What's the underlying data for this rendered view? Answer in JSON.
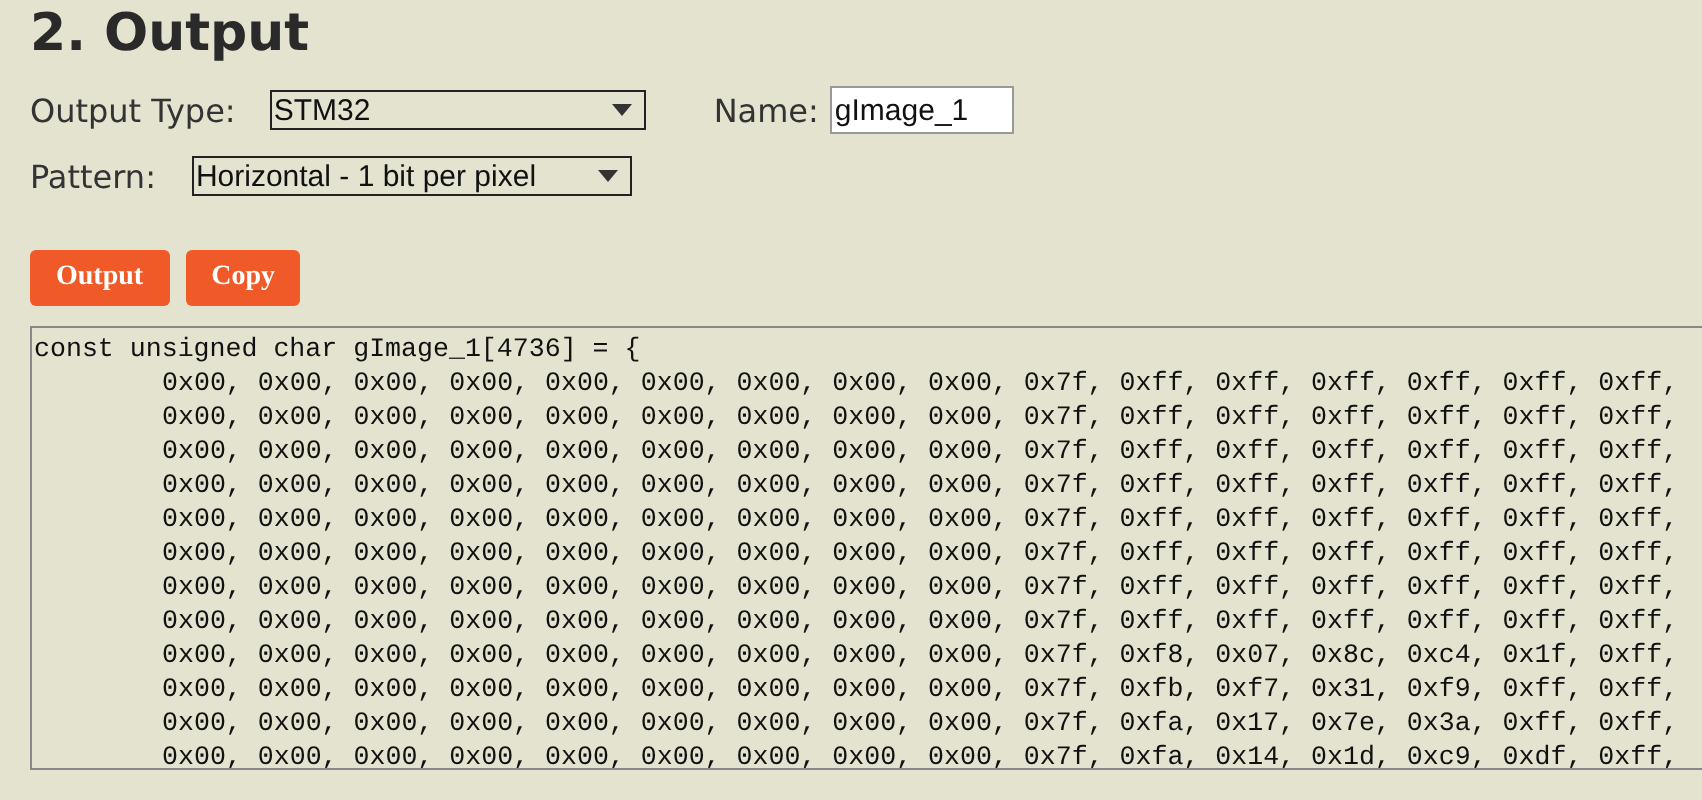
{
  "heading": "2. Output",
  "output_type": {
    "label": "Output Type:",
    "value": "STM32"
  },
  "name": {
    "label": "Name:",
    "value": "gImage_1"
  },
  "pattern": {
    "label": "Pattern:",
    "value": "Horizontal - 1 bit per pixel"
  },
  "buttons": [
    "Output",
    "Copy"
  ],
  "output": {
    "header": "const unsigned char gImage_1[4736] = {",
    "lines": [
      "0x00, 0x00, 0x00, 0x00, 0x00, 0x00, 0x00, 0x00, 0x00, 0x7f, 0xff, 0xff, 0xff, 0xff, 0xff, 0xff,",
      "0x00, 0x00, 0x00, 0x00, 0x00, 0x00, 0x00, 0x00, 0x00, 0x7f, 0xff, 0xff, 0xff, 0xff, 0xff, 0xff,",
      "0x00, 0x00, 0x00, 0x00, 0x00, 0x00, 0x00, 0x00, 0x00, 0x7f, 0xff, 0xff, 0xff, 0xff, 0xff, 0xff,",
      "0x00, 0x00, 0x00, 0x00, 0x00, 0x00, 0x00, 0x00, 0x00, 0x7f, 0xff, 0xff, 0xff, 0xff, 0xff, 0xff,",
      "0x00, 0x00, 0x00, 0x00, 0x00, 0x00, 0x00, 0x00, 0x00, 0x7f, 0xff, 0xff, 0xff, 0xff, 0xff, 0xff,",
      "0x00, 0x00, 0x00, 0x00, 0x00, 0x00, 0x00, 0x00, 0x00, 0x7f, 0xff, 0xff, 0xff, 0xff, 0xff, 0xff,",
      "0x00, 0x00, 0x00, 0x00, 0x00, 0x00, 0x00, 0x00, 0x00, 0x7f, 0xff, 0xff, 0xff, 0xff, 0xff, 0xff,",
      "0x00, 0x00, 0x00, 0x00, 0x00, 0x00, 0x00, 0x00, 0x00, 0x7f, 0xff, 0xff, 0xff, 0xff, 0xff, 0xff,",
      "0x00, 0x00, 0x00, 0x00, 0x00, 0x00, 0x00, 0x00, 0x00, 0x7f, 0xf8, 0x07, 0x8c, 0xc4, 0x1f, 0xff,",
      "0x00, 0x00, 0x00, 0x00, 0x00, 0x00, 0x00, 0x00, 0x00, 0x7f, 0xfb, 0xf7, 0x31, 0xf9, 0xff, 0xff,",
      "0x00, 0x00, 0x00, 0x00, 0x00, 0x00, 0x00, 0x00, 0x00, 0x7f, 0xfa, 0x17, 0x7e, 0x3a, 0xff, 0xff,",
      "0x00, 0x00, 0x00, 0x00, 0x00, 0x00, 0x00, 0x00, 0x00, 0x7f, 0xfa, 0x14, 0x1d, 0xc9, 0xdf, 0xff,"
    ]
  }
}
